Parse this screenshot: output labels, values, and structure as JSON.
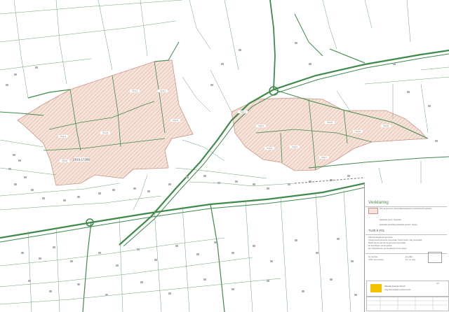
{
  "map": {
    "parcel_labels": [
      {
        "id": "p1",
        "text": "2016-17266",
        "emphasis": true
      },
      {
        "id": "p2",
        "text": "TL1-1"
      },
      {
        "id": "p3",
        "text": "TL1-2"
      },
      {
        "id": "p4",
        "text": "TL1-3"
      },
      {
        "id": "p5",
        "text": "TL1-4"
      },
      {
        "id": "p6",
        "text": "TL1-5"
      },
      {
        "id": "p7",
        "text": "TL1-6"
      },
      {
        "id": "p8",
        "text": "TL2-1"
      },
      {
        "id": "p9",
        "text": "TL2-2"
      },
      {
        "id": "p10",
        "text": "TL2-3"
      },
      {
        "id": "p11",
        "text": "TL2-4"
      },
      {
        "id": "p12",
        "text": "TL2-5"
      },
      {
        "id": "p13",
        "text": "TL2-6"
      },
      {
        "id": "p14",
        "text": "TL2-7"
      },
      {
        "id": "p15",
        "text": "TL2-8"
      }
    ],
    "colors": {
      "road": "#3f8a4b",
      "parcel_fill": "#f6e3d9",
      "parcel_edge": "#c99685",
      "hatch": "#d9a899",
      "building": "#a6a6a6"
    }
  },
  "legend": {
    "title": "Verklaring",
    "items": [
      {
        "swatch": "pink-hatch",
        "text": "Door de gemeente Veenendaal aangewezen voorkeursrecht gebieden"
      },
      {
        "swatch": "none",
        "text": "kadastrale grens / Topografie"
      },
      {
        "swatch": "none",
        "text": "Kadastrale aanduiding kadastrale perceel / dossier"
      }
    ],
    "code": "TL00 8 Y01",
    "notes": [
      "Kaart als aangegeven gemeente",
      "Voorkeursrecht gemeente Veenendaal, Twente Noord, Vlag Veenendaal",
      "Besluit van de raad van de gemeente Veenendaal",
      "De beperkingen van het gebied",
      "De rechthebbenden van de gebieden in het register"
    ],
    "signatures": [
      {
        "role": "De voorzitter",
        "name": "H.P.M. van Leeuwen"
      },
      {
        "role": "De griffier",
        "name": "W.J. de Jong"
      }
    ]
  },
  "title_block": {
    "logo_color": "#f3c300",
    "title": "Situatie Twente Noord",
    "subtitle": "Vlag Veenendaal voorkeursrecht",
    "sheet": "A3"
  }
}
